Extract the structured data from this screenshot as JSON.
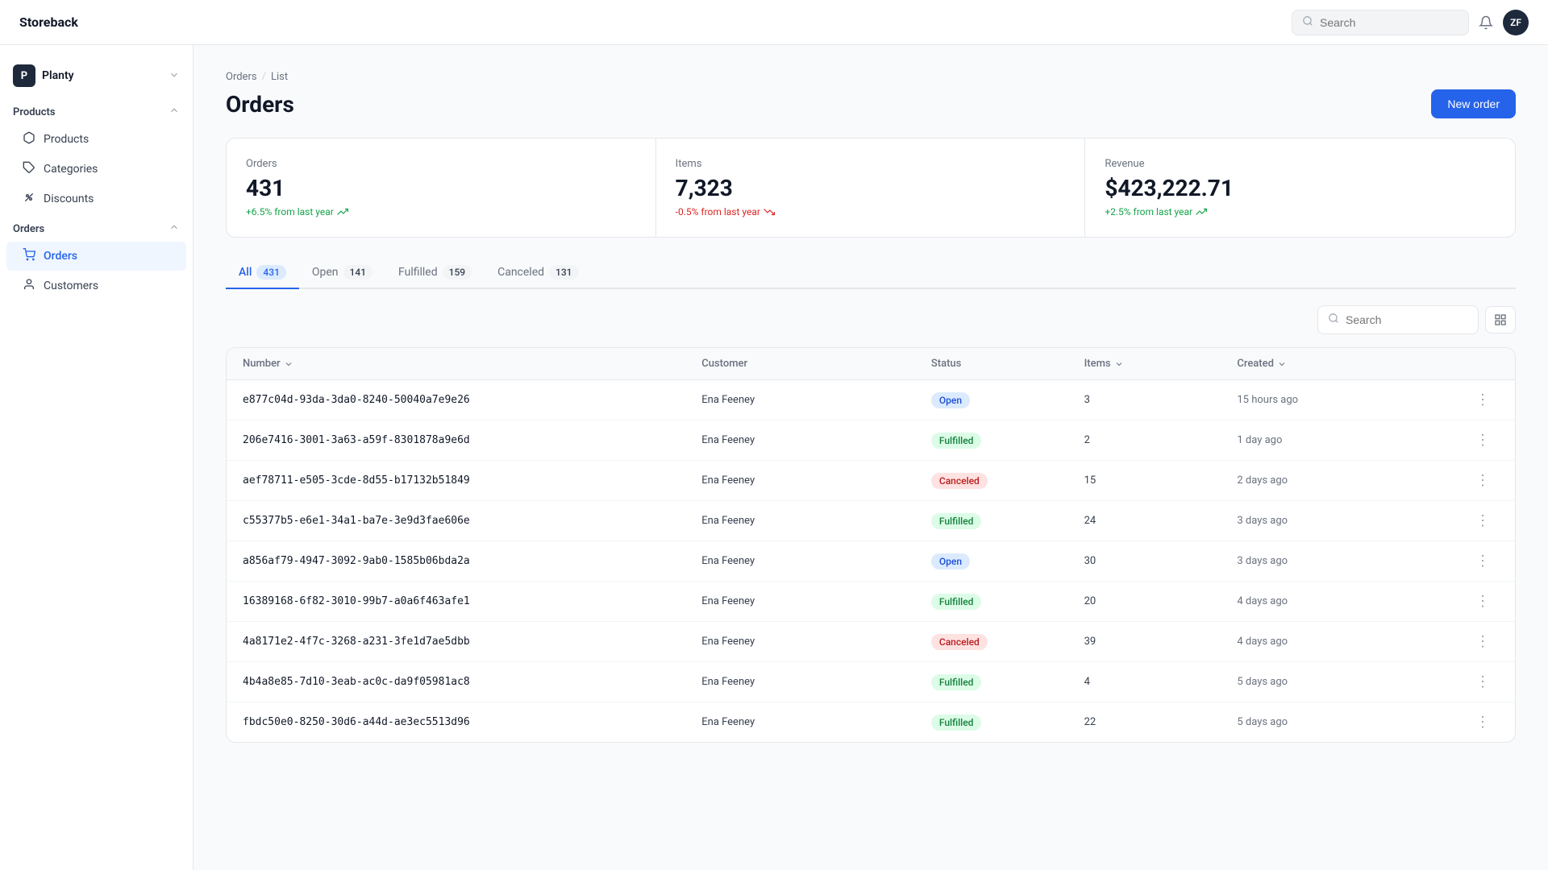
{
  "app": {
    "logo": "Storeback",
    "search_placeholder": "Search",
    "avatar_initials": "ZF"
  },
  "sidebar": {
    "store_initial": "P",
    "store_name": "Planty",
    "sections": [
      {
        "title": "Products",
        "items": [
          {
            "id": "products",
            "label": "Products",
            "icon": "📦"
          },
          {
            "id": "categories",
            "label": "Categories",
            "icon": "🏷️"
          },
          {
            "id": "discounts",
            "label": "Discounts",
            "icon": "🎫"
          }
        ]
      },
      {
        "title": "Orders",
        "items": [
          {
            "id": "orders",
            "label": "Orders",
            "icon": "🛒",
            "active": true
          },
          {
            "id": "customers",
            "label": "Customers",
            "icon": "👤"
          }
        ]
      }
    ]
  },
  "breadcrumb": {
    "items": [
      "Orders",
      "List"
    ]
  },
  "page": {
    "title": "Orders",
    "new_order_label": "New order"
  },
  "stats": [
    {
      "label": "Orders",
      "value": "431",
      "change": "+6.5% from last year",
      "positive": true
    },
    {
      "label": "Items",
      "value": "7,323",
      "change": "-0.5% from last year",
      "positive": false
    },
    {
      "label": "Revenue",
      "value": "$423,222.71",
      "change": "+2.5% from last year",
      "positive": true
    }
  ],
  "tabs": [
    {
      "label": "All",
      "count": "431",
      "active": true
    },
    {
      "label": "Open",
      "count": "141",
      "active": false
    },
    {
      "label": "Fulfilled",
      "count": "159",
      "active": false
    },
    {
      "label": "Canceled",
      "count": "131",
      "active": false
    }
  ],
  "table": {
    "search_placeholder": "Search",
    "columns": [
      "Number",
      "Customer",
      "Status",
      "Items",
      "Created"
    ],
    "rows": [
      {
        "id": "e877c04d-93da-3da0-8240-50040a7e9e26",
        "customer": "Ena Feeney",
        "status": "Open",
        "items": "3",
        "created": "15 hours ago"
      },
      {
        "id": "206e7416-3001-3a63-a59f-8301878a9e6d",
        "customer": "Ena Feeney",
        "status": "Fulfilled",
        "items": "2",
        "created": "1 day ago"
      },
      {
        "id": "aef78711-e505-3cde-8d55-b17132b51849",
        "customer": "Ena Feeney",
        "status": "Canceled",
        "items": "15",
        "created": "2 days ago"
      },
      {
        "id": "c55377b5-e6e1-34a1-ba7e-3e9d3fae606e",
        "customer": "Ena Feeney",
        "status": "Fulfilled",
        "items": "24",
        "created": "3 days ago"
      },
      {
        "id": "a856af79-4947-3092-9ab0-1585b06bda2a",
        "customer": "Ena Feeney",
        "status": "Open",
        "items": "30",
        "created": "3 days ago"
      },
      {
        "id": "16389168-6f82-3010-99b7-a0a6f463afe1",
        "customer": "Ena Feeney",
        "status": "Fulfilled",
        "items": "20",
        "created": "4 days ago"
      },
      {
        "id": "4a8171e2-4f7c-3268-a231-3fe1d7ae5dbb",
        "customer": "Ena Feeney",
        "status": "Canceled",
        "items": "39",
        "created": "4 days ago"
      },
      {
        "id": "4b4a8e85-7d10-3eab-ac0c-da9f05981ac8",
        "customer": "Ena Feeney",
        "status": "Fulfilled",
        "items": "4",
        "created": "5 days ago"
      },
      {
        "id": "fbdc50e0-8250-30d6-a44d-ae3ec5513d96",
        "customer": "Ena Feeney",
        "status": "Fulfilled",
        "items": "22",
        "created": "5 days ago"
      }
    ]
  }
}
